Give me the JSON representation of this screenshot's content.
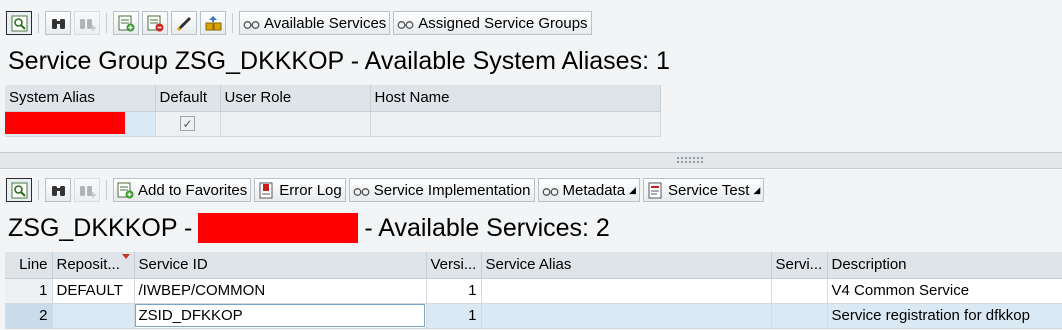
{
  "top_toolbar": {
    "available_services_label": "Available Services",
    "assigned_service_groups_label": "Assigned Service Groups"
  },
  "top_panel": {
    "title": "Service Group ZSG_DKKKOP - Available System Aliases: 1",
    "columns": [
      "System Alias",
      "Default",
      "User Role",
      "Host Name"
    ],
    "row": {
      "system_alias": "",
      "default_checked": true,
      "user_role": "",
      "host_name": ""
    }
  },
  "bottom_toolbar": {
    "add_to_favorites_label": "Add to Favorites",
    "error_log_label": "Error Log",
    "service_implementation_label": "Service Implementation",
    "metadata_label": "Metadata",
    "service_test_label": "Service Test"
  },
  "bottom_panel": {
    "title_prefix": "ZSG_DKKKOP -",
    "title_suffix": "- Available Services: 2",
    "columns": [
      "Line",
      "Reposit...",
      "Service ID",
      "Versi...",
      "Service Alias",
      "Servi...",
      "Description"
    ],
    "rows": [
      {
        "line": "1",
        "repository": "DEFAULT",
        "service_id": "/IWBEP/COMMON",
        "version": "1",
        "service_alias": "",
        "service": "",
        "description": "V4 Common Service"
      },
      {
        "line": "2",
        "repository": "",
        "service_id": "ZSID_DFKKOP",
        "version": "1",
        "service_alias": "",
        "service": "",
        "description": "Service registration for dfkkop"
      }
    ]
  }
}
